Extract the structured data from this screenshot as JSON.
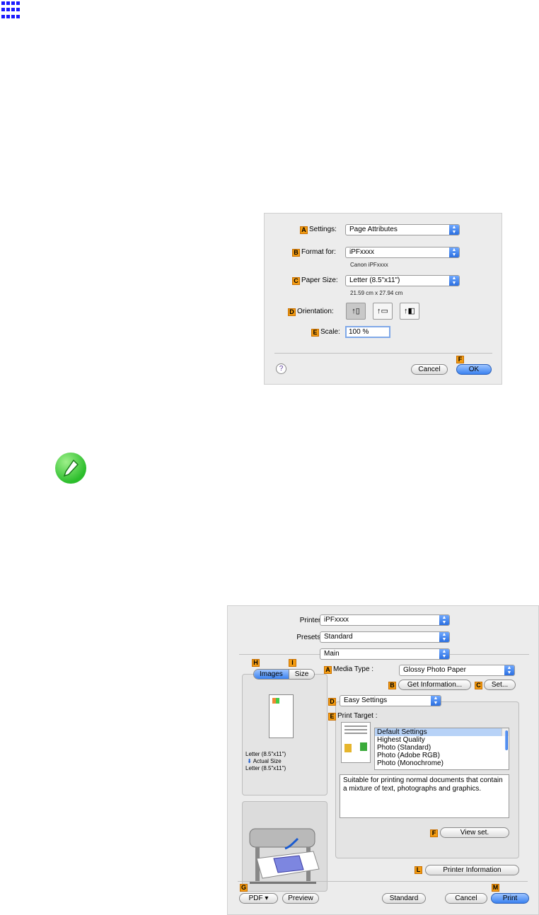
{
  "page_setup": {
    "settings_label": "Settings:",
    "settings_value": "Page Attributes",
    "format_label": "Format for:",
    "format_value": "iPFxxxx",
    "format_sub": "Canon iPFxxxx",
    "paper_label": "Paper Size:",
    "paper_value": "Letter (8.5\"x11\")",
    "paper_sub": "21.59 cm x 27.94 cm",
    "orientation_label": "Orientation:",
    "scale_label": "Scale:",
    "scale_value": "100 %",
    "help": "?",
    "cancel": "Cancel",
    "ok": "OK",
    "badges": {
      "a": "A",
      "b": "B",
      "c": "C",
      "d": "D",
      "e": "E",
      "f": "F"
    }
  },
  "print": {
    "printer_label": "Printer:",
    "printer_value": "iPFxxxx",
    "presets_label": "Presets:",
    "presets_value": "Standard",
    "panel_value": "Main",
    "tab_images": "Images",
    "tab_size": "Size",
    "preview_text1": "Letter (8.5\"x11\")",
    "preview_text2": "Actual Size",
    "preview_text3": "Letter (8.5\"x11\")",
    "media_type_label": "Media Type :",
    "media_type_value": "Glossy Photo Paper",
    "get_info": "Get Information...",
    "set_btn": "Set...",
    "mode_value": "Easy Settings",
    "print_target_label": "Print Target :",
    "targets": [
      "Default Settings",
      "Highest Quality",
      "Photo (Standard)",
      "Photo (Adobe RGB)",
      "Photo (Monochrome)"
    ],
    "description": "Suitable for printing normal documents that contain a mixture of text, photographs and graphics.",
    "view_set": "View set.",
    "printer_info": "Printer Information",
    "pdf": "PDF ▾",
    "preview_btn": "Preview",
    "standard_btn": "Standard",
    "cancel": "Cancel",
    "print_btn": "Print",
    "badges": {
      "a": "A",
      "b": "B",
      "c": "C",
      "d": "D",
      "e": "E",
      "f": "F",
      "g": "G",
      "h": "H",
      "i": "I",
      "l": "L",
      "m": "M"
    }
  }
}
